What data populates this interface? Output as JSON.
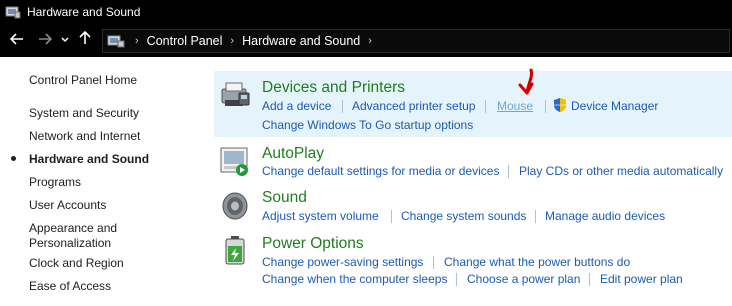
{
  "window": {
    "title": "Hardware and Sound"
  },
  "addressbar": {
    "crumbs": [
      "Control Panel",
      "Hardware and Sound"
    ]
  },
  "sidebar": {
    "home": "Control Panel Home",
    "items": [
      "System and Security",
      "Network and Internet",
      "Hardware and Sound",
      "Programs",
      "User Accounts",
      "Appearance and",
      "Personalization",
      "Clock and Region",
      "Ease of Access"
    ]
  },
  "categories": {
    "devices": {
      "title": "Devices and Printers",
      "links": [
        "Add a device",
        "Advanced printer setup",
        "Mouse",
        "Device Manager",
        "Change Windows To Go startup options"
      ]
    },
    "autoplay": {
      "title": "AutoPlay",
      "links": [
        "Change default settings for media or devices",
        "Play CDs or other media automatically"
      ]
    },
    "sound": {
      "title": "Sound",
      "links": [
        "Adjust system volume",
        "Change system sounds",
        "Manage audio devices"
      ]
    },
    "power": {
      "title": "Power Options",
      "links": [
        "Change power-saving settings",
        "Change what the power buttons do",
        "Change when the computer sleeps",
        "Choose a power plan",
        "Edit power plan"
      ]
    }
  },
  "icons": {
    "back": "arrow-left-icon",
    "forward": "arrow-right-icon",
    "recent": "chevron-down-icon",
    "up": "arrow-up-icon",
    "annotation": "red-arrow-annotation"
  },
  "colors": {
    "title_green": "#1e7e1e",
    "link_blue": "#1c5ab4",
    "highlight": "#e5f3fb"
  }
}
